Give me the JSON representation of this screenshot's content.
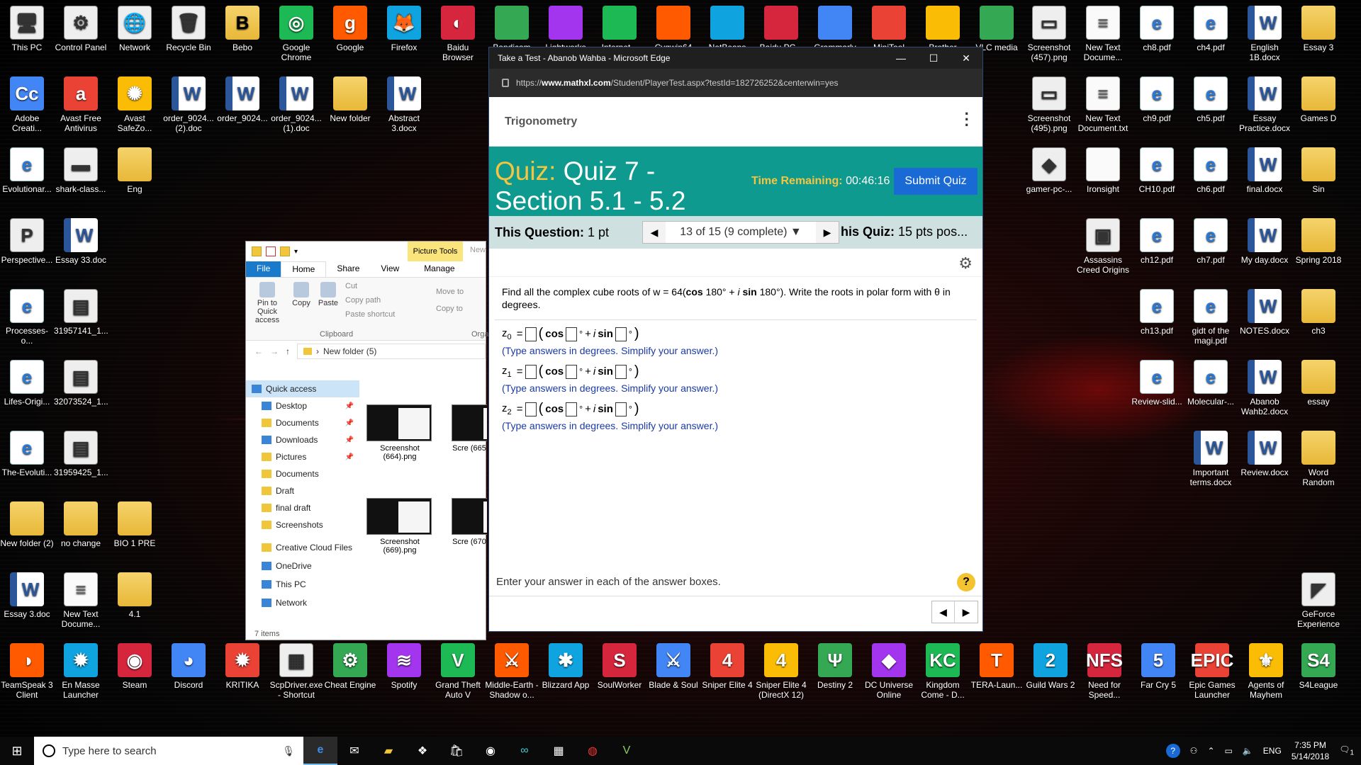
{
  "desktop_icons": [
    {
      "label": "This PC",
      "glyph": "🖥",
      "cls": "g-img"
    },
    {
      "label": "Control Panel",
      "glyph": "⚙",
      "cls": "g-img"
    },
    {
      "label": "Network",
      "glyph": "🌐",
      "cls": "g-img"
    },
    {
      "label": "Recycle Bin",
      "glyph": "🗑",
      "cls": "g-img"
    },
    {
      "label": "Bebo",
      "glyph": "B",
      "cls": "g-folder"
    },
    {
      "label": "Google Chrome",
      "glyph": "◎",
      "cls": "g-app"
    },
    {
      "label": "Google",
      "glyph": "g",
      "cls": "g-app"
    },
    {
      "label": "Firefox",
      "glyph": "🦊",
      "cls": "g-app"
    },
    {
      "label": "Baidu Browser",
      "glyph": "◐",
      "cls": "g-app"
    },
    {
      "label": "Adobe Creati...",
      "glyph": "Cc",
      "cls": "g-app"
    },
    {
      "label": "Avast Free Antivirus",
      "glyph": "a",
      "cls": "g-app"
    },
    {
      "label": "Avast SafeZo...",
      "glyph": "✺",
      "cls": "g-app"
    },
    {
      "label": "order_9024...(2).doc",
      "glyph": "W",
      "cls": "g-doc"
    },
    {
      "label": "order_9024...",
      "glyph": "W",
      "cls": "g-doc"
    },
    {
      "label": "order_9024...(1).doc",
      "glyph": "W",
      "cls": "g-doc"
    },
    {
      "label": "New folder",
      "glyph": "",
      "cls": "g-folder"
    },
    {
      "label": "Abstract 3.docx",
      "glyph": "W",
      "cls": "g-doc"
    },
    {
      "label": "Evolutionar...",
      "glyph": "e",
      "cls": "g-pdf"
    },
    {
      "label": "shark-class...",
      "glyph": "▬",
      "cls": "g-img"
    },
    {
      "label": "Eng",
      "glyph": "",
      "cls": "g-folder"
    },
    {
      "label": "Perspective...",
      "glyph": "P",
      "cls": "g-img"
    },
    {
      "label": "Essay 33.doc",
      "glyph": "W",
      "cls": "g-doc"
    },
    {
      "label": "Processes-o...",
      "glyph": "e",
      "cls": "g-pdf"
    },
    {
      "label": "31957141_1...",
      "glyph": "▤",
      "cls": "g-img"
    },
    {
      "label": "Lifes-Origi...",
      "glyph": "e",
      "cls": "g-pdf"
    },
    {
      "label": "32073524_1...",
      "glyph": "▤",
      "cls": "g-img"
    },
    {
      "label": "The-Evoluti...",
      "glyph": "e",
      "cls": "g-pdf"
    },
    {
      "label": "31959425_1...",
      "glyph": "▤",
      "cls": "g-img"
    },
    {
      "label": "New folder (2)",
      "glyph": "",
      "cls": "g-folder"
    },
    {
      "label": "no change",
      "glyph": "",
      "cls": "g-folder"
    },
    {
      "label": "BIO 1 PRE",
      "glyph": "",
      "cls": "g-folder"
    },
    {
      "label": "Essay 3.doc",
      "glyph": "W",
      "cls": "g-doc"
    },
    {
      "label": "New Text Docume...",
      "glyph": "≡",
      "cls": "g-txt"
    },
    {
      "label": "4.1",
      "glyph": "",
      "cls": "g-folder"
    },
    {
      "label": "Screenshot (457).png",
      "glyph": "▭",
      "cls": "g-img"
    },
    {
      "label": "New Text Docume...",
      "glyph": "≡",
      "cls": "g-txt"
    },
    {
      "label": "ch8.pdf",
      "glyph": "e",
      "cls": "g-pdf"
    },
    {
      "label": "ch4.pdf",
      "glyph": "e",
      "cls": "g-pdf"
    },
    {
      "label": "English 1B.docx",
      "glyph": "W",
      "cls": "g-doc"
    },
    {
      "label": "Essay 3",
      "glyph": "",
      "cls": "g-folder"
    },
    {
      "label": "Screenshot (495).png",
      "glyph": "▭",
      "cls": "g-img"
    },
    {
      "label": "New Text Document.txt",
      "glyph": "≡",
      "cls": "g-txt"
    },
    {
      "label": "ch9.pdf",
      "glyph": "e",
      "cls": "g-pdf"
    },
    {
      "label": "ch5.pdf",
      "glyph": "e",
      "cls": "g-pdf"
    },
    {
      "label": "Essay Practice.docx",
      "glyph": "W",
      "cls": "g-doc"
    },
    {
      "label": "Games D",
      "glyph": "",
      "cls": "g-folder"
    },
    {
      "label": "gamer-pc-...",
      "glyph": "◆",
      "cls": "g-img"
    },
    {
      "label": "Ironsight",
      "glyph": "",
      "cls": "g-txt"
    },
    {
      "label": "CH10.pdf",
      "glyph": "e",
      "cls": "g-pdf"
    },
    {
      "label": "ch6.pdf",
      "glyph": "e",
      "cls": "g-pdf"
    },
    {
      "label": "final.docx",
      "glyph": "W",
      "cls": "g-doc"
    },
    {
      "label": "Sin",
      "glyph": "",
      "cls": "g-folder"
    },
    {
      "label": "Assassins Creed Origins",
      "glyph": "▣",
      "cls": "g-img"
    },
    {
      "label": "ch12.pdf",
      "glyph": "e",
      "cls": "g-pdf"
    },
    {
      "label": "ch7.pdf",
      "glyph": "e",
      "cls": "g-pdf"
    },
    {
      "label": "My day.docx",
      "glyph": "W",
      "cls": "g-doc"
    },
    {
      "label": "Spring 2018",
      "glyph": "",
      "cls": "g-folder"
    },
    {
      "label": "ch13.pdf",
      "glyph": "e",
      "cls": "g-pdf"
    },
    {
      "label": "gidt of the magi.pdf",
      "glyph": "e",
      "cls": "g-pdf"
    },
    {
      "label": "NOTES.docx",
      "glyph": "W",
      "cls": "g-doc"
    },
    {
      "label": "ch3",
      "glyph": "",
      "cls": "g-folder"
    },
    {
      "label": "Review-slid...",
      "glyph": "e",
      "cls": "g-pdf"
    },
    {
      "label": "Molecular-...",
      "glyph": "e",
      "cls": "g-pdf"
    },
    {
      "label": "Abanob Wahb2.docx",
      "glyph": "W",
      "cls": "g-doc"
    },
    {
      "label": "essay",
      "glyph": "",
      "cls": "g-folder"
    },
    {
      "label": "Important terms.docx",
      "glyph": "W",
      "cls": "g-doc"
    },
    {
      "label": "Review.docx",
      "glyph": "W",
      "cls": "g-doc"
    },
    {
      "label": "Word Random",
      "glyph": "",
      "cls": "g-folder"
    },
    {
      "label": "GeForce Experience",
      "glyph": "◤",
      "cls": "g-img"
    },
    {
      "label": "TeamSpeak 3 Client",
      "glyph": "◑",
      "cls": "g-app"
    },
    {
      "label": "En Masse Launcher",
      "glyph": "✹",
      "cls": "g-app"
    },
    {
      "label": "Steam",
      "glyph": "◉",
      "cls": "g-app"
    },
    {
      "label": "Discord",
      "glyph": "◕",
      "cls": "g-app"
    },
    {
      "label": "KRITIKA",
      "glyph": "✹",
      "cls": "g-app"
    },
    {
      "label": "ScpDriver.exe - Shortcut",
      "glyph": "▦",
      "cls": "g-img"
    },
    {
      "label": "Cheat Engine",
      "glyph": "⚙",
      "cls": "g-app"
    },
    {
      "label": "Spotify",
      "glyph": "≋",
      "cls": "g-app"
    },
    {
      "label": "Grand Theft Auto V",
      "glyph": "V",
      "cls": "g-app"
    },
    {
      "label": "Middle-Earth - Shadow o...",
      "glyph": "⚔",
      "cls": "g-app"
    },
    {
      "label": "Blizzard App",
      "glyph": "✱",
      "cls": "g-app"
    },
    {
      "label": "SoulWorker",
      "glyph": "S",
      "cls": "g-app"
    },
    {
      "label": "Blade & Soul",
      "glyph": "⚔",
      "cls": "g-app"
    },
    {
      "label": "Sniper Elite 4",
      "glyph": "4",
      "cls": "g-app"
    },
    {
      "label": "Sniper Elite 4 (DirectX 12)",
      "glyph": "4",
      "cls": "g-app"
    },
    {
      "label": "Destiny 2",
      "glyph": "Ψ",
      "cls": "g-app"
    },
    {
      "label": "DC Universe Online",
      "glyph": "◆",
      "cls": "g-app"
    },
    {
      "label": "Kingdom Come - D...",
      "glyph": "KC",
      "cls": "g-app"
    },
    {
      "label": "TERA-Laun...",
      "glyph": "T",
      "cls": "g-app"
    },
    {
      "label": "Guild Wars 2",
      "glyph": "2",
      "cls": "g-app"
    },
    {
      "label": "Need for Speed...",
      "glyph": "NFS",
      "cls": "g-app"
    },
    {
      "label": "Far Cry 5",
      "glyph": "5",
      "cls": "g-app"
    },
    {
      "label": "Epic Games Launcher",
      "glyph": "EPIC",
      "cls": "g-app"
    },
    {
      "label": "Agents of Mayhem",
      "glyph": "⚜",
      "cls": "g-app"
    },
    {
      "label": "S4League",
      "glyph": "S4",
      "cls": "g-app"
    }
  ],
  "top_row_partial": [
    "Bandicam",
    "Lightworks",
    "Internet...",
    "Cygwin64",
    "NetBeans IDE",
    "Baidu PC...",
    "Grammarly",
    "MiniTool",
    "Brother",
    "VLC media player"
  ],
  "explorer": {
    "picture_tools": "Picture Tools",
    "new_tab": "New",
    "tabs": [
      "File",
      "Home",
      "Share",
      "View",
      "Manage"
    ],
    "ribbon": {
      "pin": "Pin to Quick access",
      "copy": "Copy",
      "paste": "Paste",
      "cut": "Cut",
      "copy_path": "Copy path",
      "paste_shortcut": "Paste shortcut",
      "move_to": "Move to",
      "copy_to": "Copy to",
      "clipboard": "Clipboard",
      "org": "Orga"
    },
    "path": "New folder (5)",
    "nav": [
      {
        "label": "Quick access",
        "pin": false
      },
      {
        "label": "Desktop",
        "pin": true
      },
      {
        "label": "Documents",
        "pin": true
      },
      {
        "label": "Downloads",
        "pin": true
      },
      {
        "label": "Pictures",
        "pin": true
      },
      {
        "label": "Documents",
        "pin": false
      },
      {
        "label": "Draft",
        "pin": false
      },
      {
        "label": "final draft",
        "pin": false
      },
      {
        "label": "Screenshots",
        "pin": false
      },
      {
        "label": "Creative Cloud Files",
        "pin": false
      },
      {
        "label": "OneDrive",
        "pin": false
      },
      {
        "label": "This PC",
        "pin": false
      },
      {
        "label": "Network",
        "pin": false
      }
    ],
    "files": [
      "Screenshot (664).png",
      "Scre (665",
      "Screenshot (669).png",
      "Scre (670"
    ],
    "status": "7 items"
  },
  "edge": {
    "title": "Take a Test - Abanob Wahba - Microsoft Edge",
    "url_prefix": "https://",
    "url_host": "www.mathxl.com",
    "url_rest": "/Student/PlayerTest.aspx?testId=182726252&centerwin=yes",
    "course": "Trigonometry",
    "quiz_label": "Quiz:",
    "quiz_name": "Quiz 7 - Section 5.1 - 5.2",
    "time_label": "Time Remaining:",
    "time_value": "00:46:16",
    "submit": "Submit Quiz",
    "this_question_label": "This Question:",
    "this_question_value": "1 pt",
    "pager": "13 of 15 (9 complete)",
    "this_quiz_label": "his Quiz:",
    "this_quiz_value": "15 pts pos...",
    "question_pre": "Find all the complex cube roots of w = 64(",
    "question_cos": "cos",
    "question_mid": "180° + ",
    "question_i": "i",
    "question_sin": "sin",
    "question_post": "180°). Write the roots in polar form with θ in degrees.",
    "answers": [
      {
        "var": "z",
        "sub": "0"
      },
      {
        "var": "z",
        "sub": "1"
      },
      {
        "var": "z",
        "sub": "2"
      }
    ],
    "hint": "(Type answers in degrees. Simplify your answer.)",
    "footer": "Enter your answer in each of the answer boxes.",
    "help": "?"
  },
  "taskbar": {
    "search_placeholder": "Type here to search",
    "lang": "ENG",
    "time": "7:35 PM",
    "date": "5/14/2018",
    "notif_count": "1"
  }
}
